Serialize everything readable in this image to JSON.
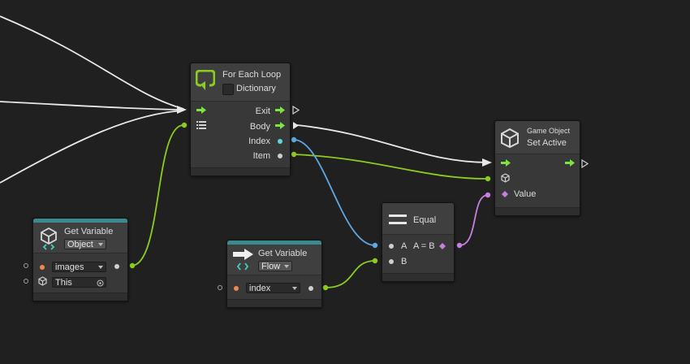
{
  "colors": {
    "background": "#202020",
    "flow": "#ffffff",
    "green": "#8ccc1f",
    "blue": "#5fa7e2",
    "purple": "#c97ee0",
    "control": "#7ee53f",
    "teal": "#3a8a8f",
    "orange": "#ee8a50"
  },
  "for_each": {
    "title": "For Each Loop",
    "checkbox_label": "Dictionary",
    "icon": "loop-icon",
    "ports": {
      "exit": "Exit",
      "body": "Body",
      "index": "Index",
      "item": "Item"
    }
  },
  "game_object": {
    "category": "Game Object",
    "title": "Set Active",
    "icon": "cube-icon",
    "port_value": "Value"
  },
  "equal": {
    "title": "Equal",
    "icon": "equals-icon",
    "port_a": "A",
    "result": "A = B",
    "port_b": "B"
  },
  "get_variable_object": {
    "title": "Get Variable",
    "kind": "Object",
    "name_value": "images",
    "target_value": "This",
    "icon": "variable-cube-icon"
  },
  "get_variable_flow": {
    "title": "Get Variable",
    "kind": "Flow",
    "name_value": "index",
    "icon": "flow-variable-icon"
  }
}
